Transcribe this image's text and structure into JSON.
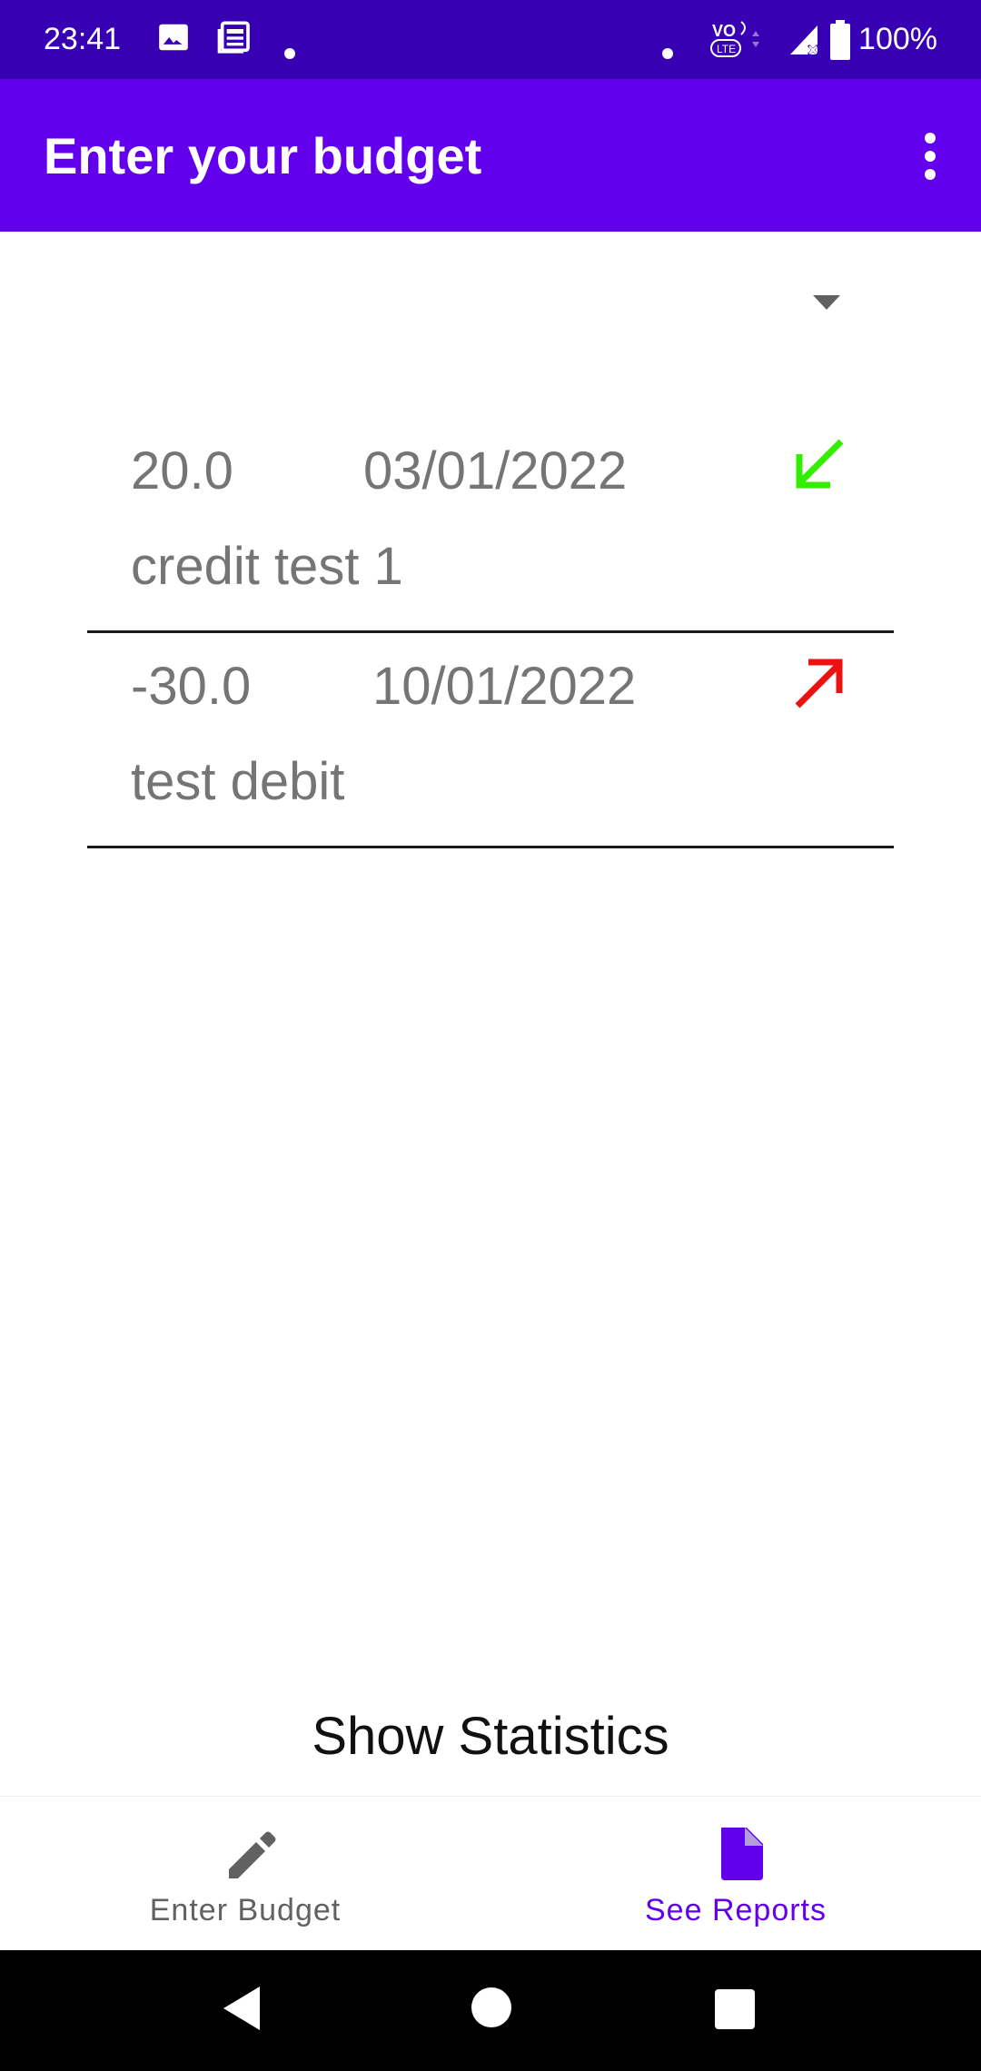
{
  "status_bar": {
    "time": "23:41",
    "battery": "100%",
    "icons": [
      "image-icon",
      "news-icon",
      "dot-icon",
      "volte-icon",
      "signal-icon",
      "battery-icon"
    ]
  },
  "app_bar": {
    "title": "Enter your budget",
    "menu_icon": "more-vert-icon"
  },
  "spinner": {
    "icon": "dropdown-arrow-icon"
  },
  "transactions": [
    {
      "amount": "20.0",
      "date": "03/01/2022",
      "description": "credit test 1",
      "direction": "credit",
      "arrow_color": "#33ee00"
    },
    {
      "amount": "-30.0",
      "date": "10/01/2022",
      "description": "test debit",
      "direction": "debit",
      "arrow_color": "#ee1111"
    }
  ],
  "show_statistics": "Show Statistics",
  "bottom_nav": {
    "items": [
      {
        "label": "Enter Budget",
        "icon": "pencil-icon",
        "selected": false
      },
      {
        "label": "See Reports",
        "icon": "document-icon",
        "selected": true
      }
    ],
    "active_color": "#6200ee",
    "inactive_color": "#616161"
  },
  "system_nav": {
    "icons": [
      "back-icon",
      "home-icon",
      "recents-icon"
    ]
  }
}
